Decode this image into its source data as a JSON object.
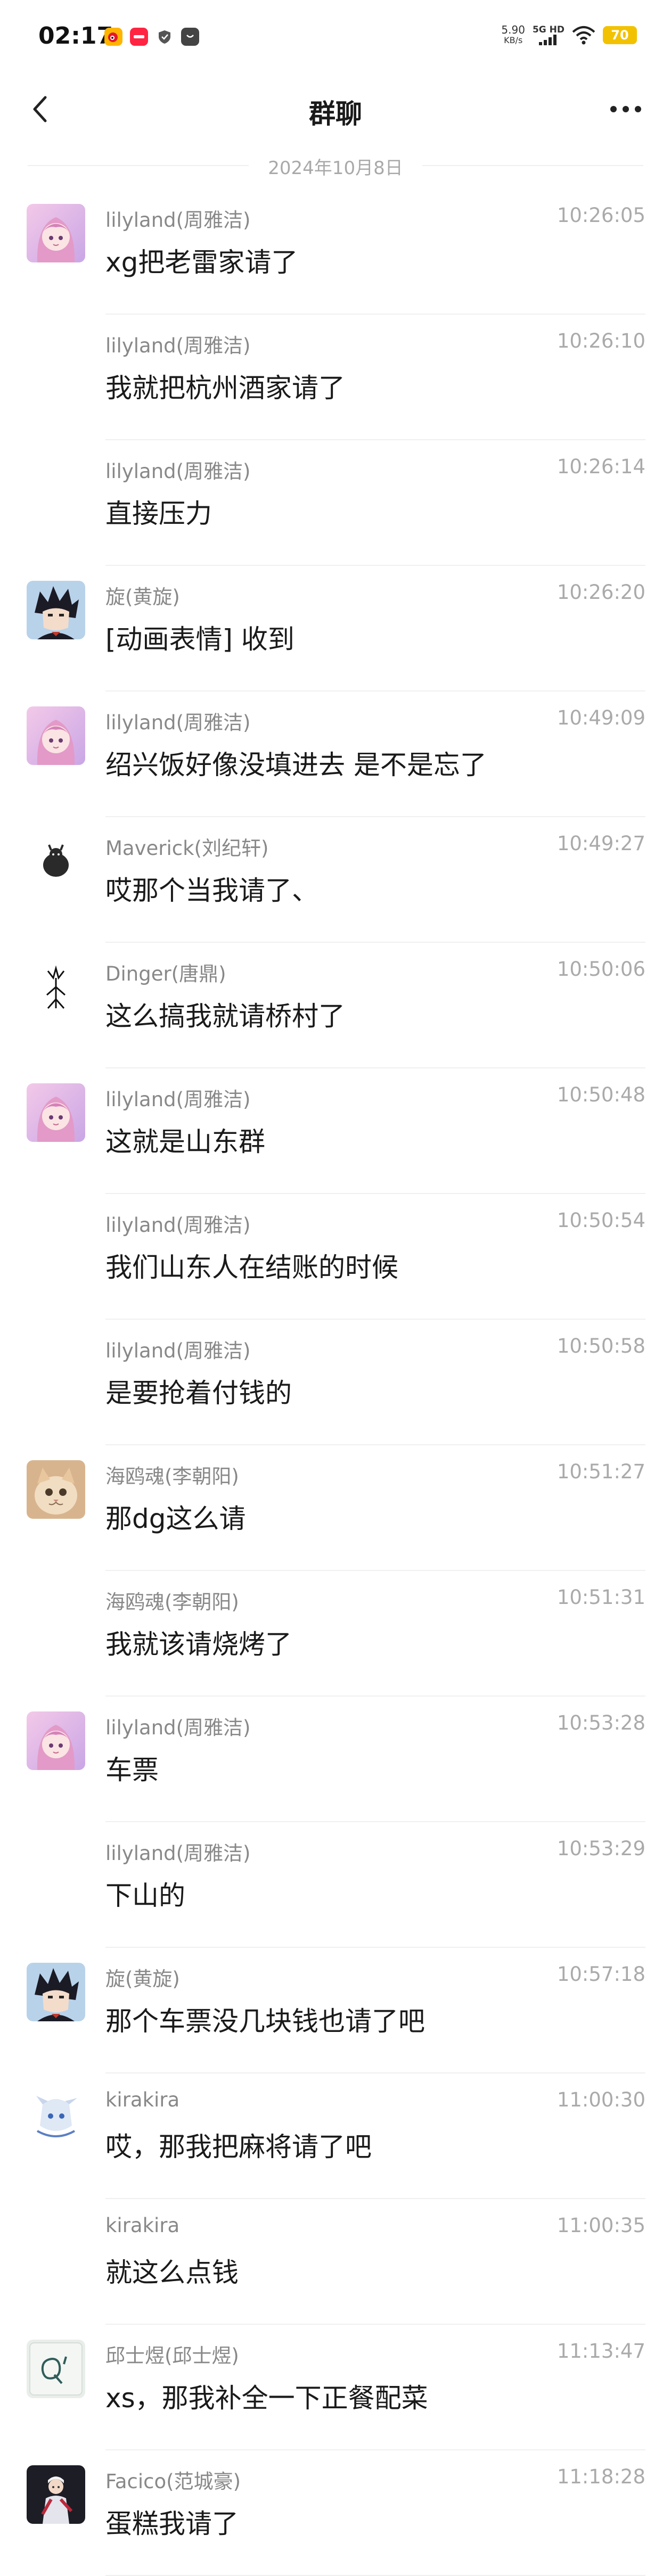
{
  "status_bar": {
    "time": "02:17",
    "net_speed_value": "5.90",
    "net_speed_unit": "KB/s",
    "net_kind_top": "5G HD",
    "battery": "70",
    "app_icons": [
      "weibo-icon",
      "red-app-icon",
      "shield-icon",
      "bag-icon"
    ]
  },
  "nav": {
    "title": "群聊"
  },
  "date_separator": "2024年10月8日",
  "colors": {
    "divider": "#f0f0f0",
    "sender_text": "#888888",
    "time_text": "#aaaaaa",
    "battery": "#f2c200"
  },
  "messages": [
    {
      "sender": "lilyland(周雅洁)",
      "time": "10:26:05",
      "text": "xg把老雷家请了",
      "avatar": "lilyland-avatar"
    },
    {
      "sender": "lilyland(周雅洁)",
      "time": "10:26:10",
      "text": "我就把杭州酒家请了",
      "avatar": ""
    },
    {
      "sender": "lilyland(周雅洁)",
      "time": "10:26:14",
      "text": "直接压力",
      "avatar": ""
    },
    {
      "sender": "旋(黄旋)",
      "time": "10:26:20",
      "text": "[动画表情] 收到",
      "avatar": "xuan-avatar"
    },
    {
      "sender": "lilyland(周雅洁)",
      "time": "10:49:09",
      "text": "绍兴饭好像没填进去 是不是忘了",
      "avatar": "lilyland-avatar"
    },
    {
      "sender": "Maverick(刘纪轩)",
      "time": "10:49:27",
      "text": "哎那个当我请了、",
      "avatar": "maverick-avatar"
    },
    {
      "sender": "Dinger(唐鼎)",
      "time": "10:50:06",
      "text": "这么搞我就请桥村了",
      "avatar": "dinger-avatar"
    },
    {
      "sender": "lilyland(周雅洁)",
      "time": "10:50:48",
      "text": "这就是山东群",
      "avatar": "lilyland-avatar"
    },
    {
      "sender": "lilyland(周雅洁)",
      "time": "10:50:54",
      "text": "我们山东人在结账的时候",
      "avatar": ""
    },
    {
      "sender": "lilyland(周雅洁)",
      "time": "10:50:58",
      "text": "是要抢着付钱的",
      "avatar": ""
    },
    {
      "sender": "海鸥魂(李朝阳)",
      "time": "10:51:27",
      "text": "那dg这么请",
      "avatar": "haiouhun-avatar"
    },
    {
      "sender": "海鸥魂(李朝阳)",
      "time": "10:51:31",
      "text": "我就该请烧烤了",
      "avatar": ""
    },
    {
      "sender": "lilyland(周雅洁)",
      "time": "10:53:28",
      "text": "车票",
      "avatar": "lilyland-avatar"
    },
    {
      "sender": "lilyland(周雅洁)",
      "time": "10:53:29",
      "text": "下山的",
      "avatar": ""
    },
    {
      "sender": "旋(黄旋)",
      "time": "10:57:18",
      "text": "那个车票没几块钱也请了吧",
      "avatar": "xuan-avatar"
    },
    {
      "sender": "kirakira",
      "time": "11:00:30",
      "text": "哎，那我把麻将请了吧",
      "avatar": "kirakira-avatar"
    },
    {
      "sender": "kirakira",
      "time": "11:00:35",
      "text": "就这么点钱",
      "avatar": ""
    },
    {
      "sender": "邱士煜(邱士煜)",
      "time": "11:13:47",
      "text": "xs，那我补全一下正餐配菜",
      "avatar": "qiushiyu-avatar"
    },
    {
      "sender": "Facico(范城豪)",
      "time": "11:18:28",
      "text": "蛋糕我请了",
      "avatar": "facico-avatar"
    }
  ]
}
